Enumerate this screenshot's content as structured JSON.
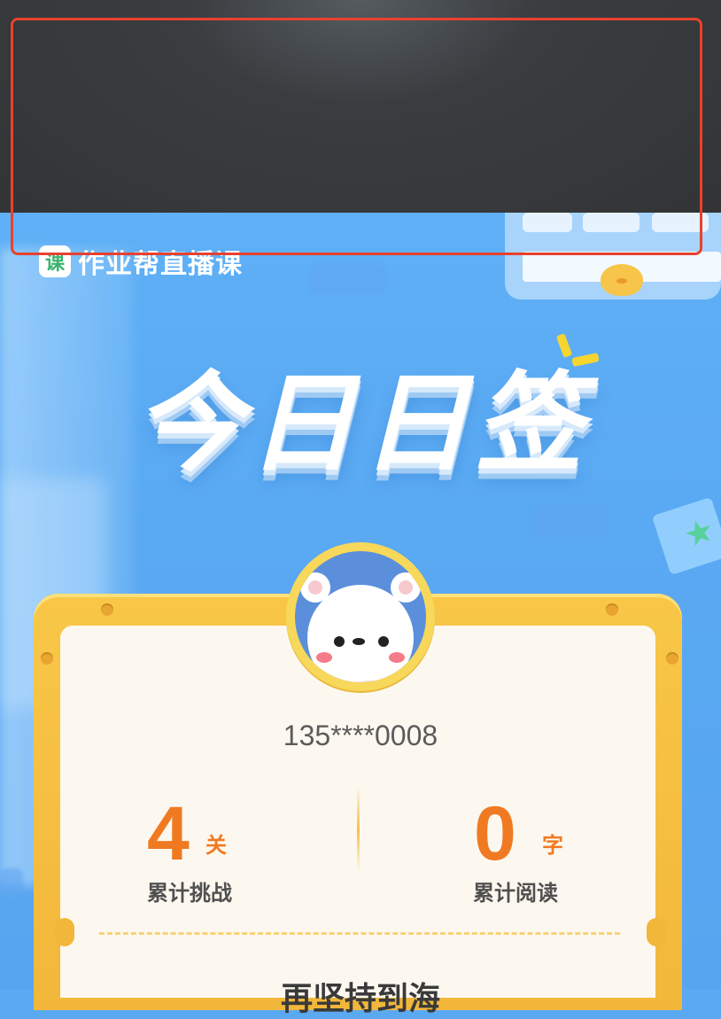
{
  "app": {
    "logo_glyph": "课",
    "name": "作业帮直播课"
  },
  "banner": {
    "title": "今日日签"
  },
  "profile": {
    "phone": "135****0008"
  },
  "stats": {
    "challenges": {
      "value": "4",
      "unit": "关",
      "label": "累计挑战"
    },
    "reading": {
      "value": "0",
      "unit": "字",
      "label": "累计阅读"
    }
  },
  "footer_partial": "再坚持到海",
  "colors": {
    "accent_orange": "#f07a22",
    "frame_gold": "#f2b73a",
    "background_blue": "#5aa9f2",
    "highlight_red": "#e8412e"
  },
  "icons": [
    "app-logo-icon",
    "bear-avatar-icon",
    "star-gem-icon",
    "sparkle-icon"
  ]
}
